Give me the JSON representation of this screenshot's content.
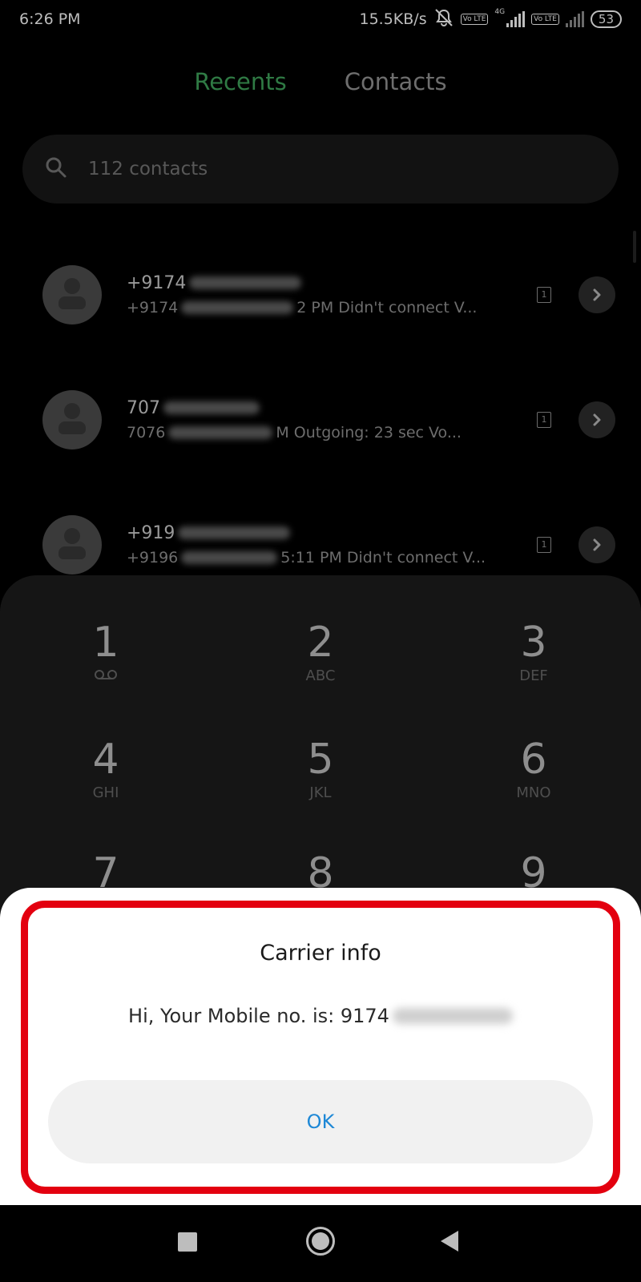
{
  "status_bar": {
    "time": "6:26 PM",
    "network_speed": "15.5KB/s",
    "volte_label": "Vo LTE",
    "network_type": "4G",
    "battery": "53"
  },
  "tabs": [
    {
      "label": "Recents",
      "active": true
    },
    {
      "label": "Contacts",
      "active": false
    }
  ],
  "search": {
    "placeholder": "112 contacts"
  },
  "calls": [
    {
      "number_prefix": "+9174",
      "detail_prefix": "+9174",
      "detail_suffix": "2 PM Didn't connect V...",
      "sim": "1"
    },
    {
      "number_prefix": "707",
      "detail_prefix": "7076",
      "detail_suffix": "M Outgoing: 23 sec Vo...",
      "sim": "1"
    },
    {
      "number_prefix": "+919",
      "detail_prefix": "+9196",
      "detail_suffix": "5:11 PM Didn't connect V...",
      "sim": "1"
    }
  ],
  "dialpad": [
    {
      "digit": "1",
      "letters": "voicemail-icon"
    },
    {
      "digit": "2",
      "letters": "ABC"
    },
    {
      "digit": "3",
      "letters": "DEF"
    },
    {
      "digit": "4",
      "letters": "GHI"
    },
    {
      "digit": "5",
      "letters": "JKL"
    },
    {
      "digit": "6",
      "letters": "MNO"
    },
    {
      "digit": "7",
      "letters": ""
    },
    {
      "digit": "8",
      "letters": ""
    },
    {
      "digit": "9",
      "letters": ""
    }
  ],
  "dialog": {
    "title": "Carrier info",
    "message": "Hi, Your Mobile no. is: 9174",
    "ok_label": "OK",
    "highlight_color": "#e3000f",
    "ok_color": "#1e88d6"
  },
  "colors": {
    "accent_tab": "#2f7a44",
    "background": "#000000"
  }
}
